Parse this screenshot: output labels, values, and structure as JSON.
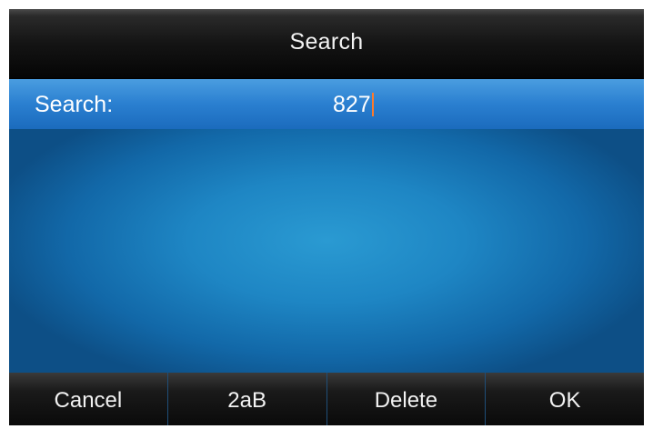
{
  "header": {
    "title": "Search"
  },
  "search": {
    "label": "Search:",
    "value": "827"
  },
  "softkeys": [
    {
      "label": "Cancel"
    },
    {
      "label": "2aB"
    },
    {
      "label": "Delete"
    },
    {
      "label": "OK"
    }
  ],
  "colors": {
    "cursor": "#ff7a2a",
    "highlight_row": "#2a7fd0",
    "background": "#1e86c4"
  }
}
